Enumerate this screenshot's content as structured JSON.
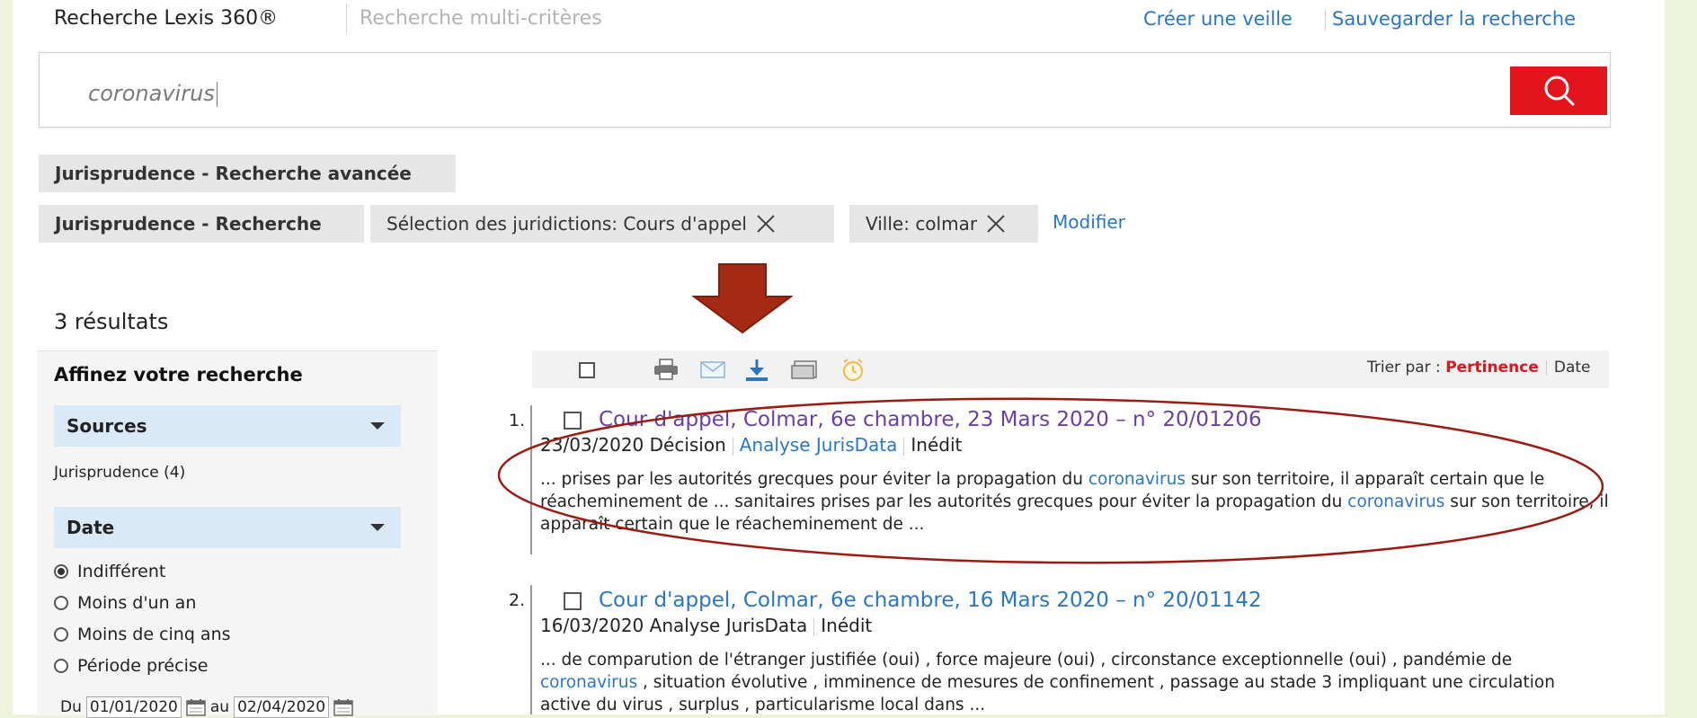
{
  "header": {
    "tab_active": "Recherche Lexis 360®",
    "tab_inactive": "Recherche multi-critères",
    "link_watch": "Créer une veille",
    "link_save": "Sauvegarder la recherche"
  },
  "search": {
    "query": "coronavirus"
  },
  "chips": {
    "advanced": "Jurisprudence - Recherche avancée",
    "search": "Jurisprudence - Recherche",
    "jurisdiction": "Sélection des juridictions: Cours d'appel",
    "city": "Ville: colmar",
    "modify": "Modifier"
  },
  "results_count": "3 résultats",
  "sidebar": {
    "title": "Affinez votre recherche",
    "sources_label": "Sources",
    "jurisprudence_item": "Jurisprudence (4)",
    "date_label": "Date",
    "radios": [
      "Indifférent",
      "Moins d'un an",
      "Moins de cinq ans",
      "Période précise"
    ],
    "date_from_label": "Du",
    "date_from": "01/01/2020",
    "date_to_label": "au",
    "date_to": "02/04/2020"
  },
  "toolbar": {
    "sort_prefix": "Trier par :",
    "sort_relevance": "Pertinence",
    "sort_date": "Date"
  },
  "results": [
    {
      "number": "1.",
      "title": "Cour d'appel, Colmar, 6e chambre, 23 Mars 2020 – n° 20/01206",
      "date_type": "23/03/2020 Décision",
      "analysis": "Analyse JurisData",
      "status": "Inédit",
      "snippet_1": "... prises par les autorités grecques pour éviter la propagation du ",
      "kw_1": "coronavirus",
      "snippet_2": " sur son territoire, il apparaît certain que le réacheminement de ... sanitaires prises par les autorités grecques pour éviter la propagation du ",
      "kw_2": "coronavirus",
      "snippet_3": " sur son territoire, il apparaît certain que le réacheminement de ..."
    },
    {
      "number": "2.",
      "title": "Cour d'appel, Colmar, 6e chambre, 16 Mars 2020 – n° 20/01142",
      "date_type": "16/03/2020 Analyse JurisData",
      "status": "Inédit",
      "snippet_1": "... de comparution de l'étranger justifiée (oui) , force majeure (oui) , circonstance exceptionnelle (oui) , pandémie de ",
      "kw_1": "coronavirus",
      "snippet_2": " , situation évolutive , imminence de mesures de confinement , passage au stade 3 impliquant une circulation active du virus , surplus , particularisme local dans ..."
    }
  ],
  "colors": {
    "accent_red": "#e3141b",
    "link_blue": "#2a76c6",
    "visited_purple": "#6b3fa0",
    "arrow": "#a52a14",
    "ellipse": "#9b1b12"
  },
  "icons": [
    "search-icon",
    "close-icon",
    "caret-down-icon",
    "print-icon",
    "mail-icon",
    "download-icon",
    "folder-icon",
    "alarm-icon",
    "calendar-icon",
    "down-arrow"
  ]
}
